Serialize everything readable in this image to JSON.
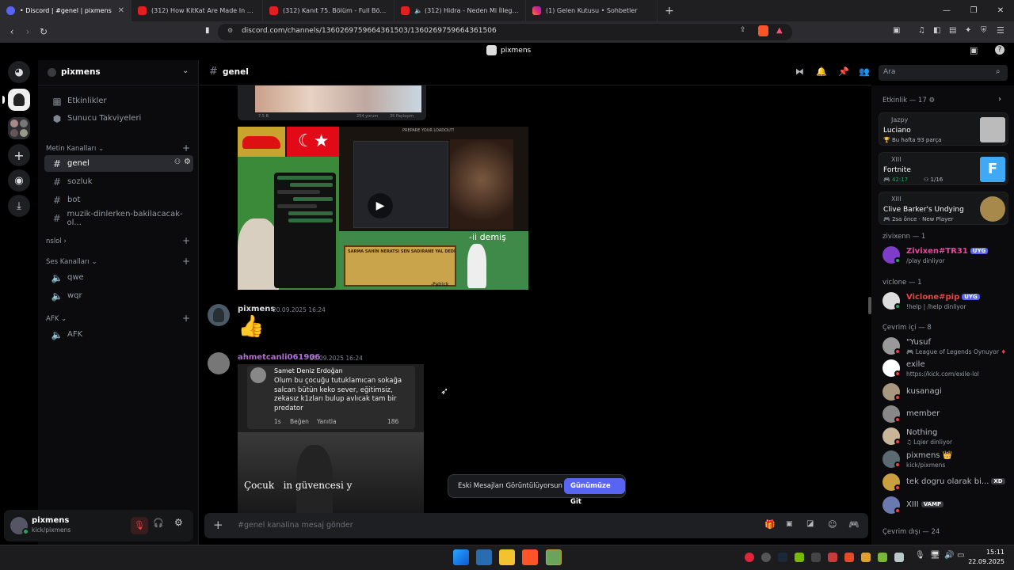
{
  "browser": {
    "tabs": [
      {
        "label": "• Discord | #genel | pixmens",
        "active": true,
        "favicon": "discord-icon"
      },
      {
        "label": "(312) How KitKat Are Made In a Factory",
        "active": false,
        "favicon": "youtube-icon"
      },
      {
        "label": "(312) Kanıt 75. Bölüm - Full Bölüm - YouTube",
        "active": false,
        "favicon": "youtube-icon"
      },
      {
        "label": "(312) Hidra - Neden Mi İllegal 3",
        "active": false,
        "favicon": "youtube-icon"
      },
      {
        "label": "(1) Gelen Kutusu • Sohbetler",
        "active": false,
        "favicon": "instagram-icon"
      }
    ],
    "url": "discord.com/channels/1360269759664361503/1360269759664361506"
  },
  "window": {
    "server_title": "pixmens"
  },
  "sidebar": {
    "server_name": "pixmens",
    "top_items": [
      {
        "label": "Etkinlikler",
        "icon": "calendar-icon"
      },
      {
        "label": "Sunucu Takviyeleri",
        "icon": "boost-icon"
      }
    ],
    "categories": [
      {
        "name": "Metin Kanalları",
        "channels": [
          "genel",
          "sozluk",
          "bot",
          "muzik-dinlerken-bakilacacak-ol..."
        ]
      },
      {
        "name": "nslol",
        "channels": []
      },
      {
        "name": "Ses Kanalları",
        "channels": [
          "qwe",
          "wqr"
        ]
      },
      {
        "name": "AFK",
        "channels": [
          "AFK"
        ]
      }
    ],
    "active_channel": "genel"
  },
  "user_panel": {
    "name": "pixmens",
    "status": "kick/pixmens"
  },
  "header": {
    "channel": "genel",
    "search_placeholder": "Ara"
  },
  "chat": {
    "messages": [
      {
        "author": "pixmens",
        "timestamp": "20.09.2025 16:24",
        "content": "👍",
        "color": "#dbdee1"
      },
      {
        "author": "ahmetcanli061906",
        "timestamp": "20.09.2025 16:24",
        "content": "",
        "color": "#b06cd9"
      }
    ],
    "meme_caption": "-ii demiş",
    "meme_name": "Samet Deniz Erdoğan",
    "meme_text": "Olum bu çocuğu tutuklamıcan sokağa salcan bütün keko sever, eğitimsiz, zekasız k1zları bulup avlıcak tam bir predator",
    "meme_meta": [
      "1s",
      "Beğen",
      "Yanıtla",
      "186"
    ],
    "meme_bottom_text": "Çocuk   in güvencesi y",
    "old_messages_label": "Eski Mesajları Görüntülüyorsun",
    "jump_present_label": "Günümüze Git",
    "composer_placeholder": "#genel kanalina mesaj gönder",
    "card_small_text": [
      "7.5 B",
      "254 yorum",
      "35 Paylaşım"
    ],
    "prepare_text": "PREPARE YOUR LOADOUT!",
    "patrick_text": "-Patrick",
    "yellow_text": "SARMA SAHİN NERATSI SEN SADIRANE YAL DEDİ"
  },
  "members": {
    "activity_header": "Etkinlik — 17",
    "activities": [
      {
        "user": "Jazpy",
        "title": "Luciano",
        "sub": "Bu hafta 93 parça"
      },
      {
        "user": "XIII",
        "title": "Fortnite",
        "time": "42:17",
        "sub": "1/16"
      },
      {
        "user": "XIII",
        "title": "Clive Barker's Undying",
        "sub": "2sa önce",
        "sub2": "New Player"
      }
    ],
    "groups": [
      {
        "name": "zivixenn — 1",
        "members": [
          {
            "name": "Zivixen#TR31",
            "badge": "UYG",
            "sub": "/play dinliyor",
            "color": "#eb459e"
          }
        ]
      },
      {
        "name": "viclone — 1",
        "members": [
          {
            "name": "Viclone#pip",
            "badge": "UYG",
            "sub": "!help | /help dinliyor",
            "color": "#ed4245"
          }
        ]
      },
      {
        "name": "Çevrim içi — 8",
        "members": [
          {
            "name": "\"Yusuf",
            "sub": "League of Legends Oynuyor",
            "color": "#b5bac1"
          },
          {
            "name": "exile",
            "sub": "https://kick.com/exile-lol",
            "color": "#b5bac1"
          },
          {
            "name": "kusanagi",
            "sub": "",
            "color": "#b5bac1"
          },
          {
            "name": "member",
            "sub": "",
            "color": "#b5bac1"
          },
          {
            "name": "Nothing",
            "sub": "Lqier dinliyor",
            "color": "#b5bac1"
          },
          {
            "name": "pixmens 👑",
            "sub": "kick/pixmens",
            "color": "#b5bac1"
          },
          {
            "name": "tek dogru olarak bi...",
            "badge": "XD",
            "sub": "",
            "color": "#b5bac1"
          },
          {
            "name": "XIII",
            "badge": "VAMP",
            "sub": "",
            "color": "#b5bac1"
          }
        ]
      },
      {
        "name": "Çevrim dışı — 24",
        "members": []
      }
    ]
  },
  "taskbar": {
    "time": "15:11",
    "date": "22.09.2025"
  },
  "colors": {
    "accent": "#5865f2",
    "online": "#23a55a",
    "dnd": "#f23f43"
  }
}
